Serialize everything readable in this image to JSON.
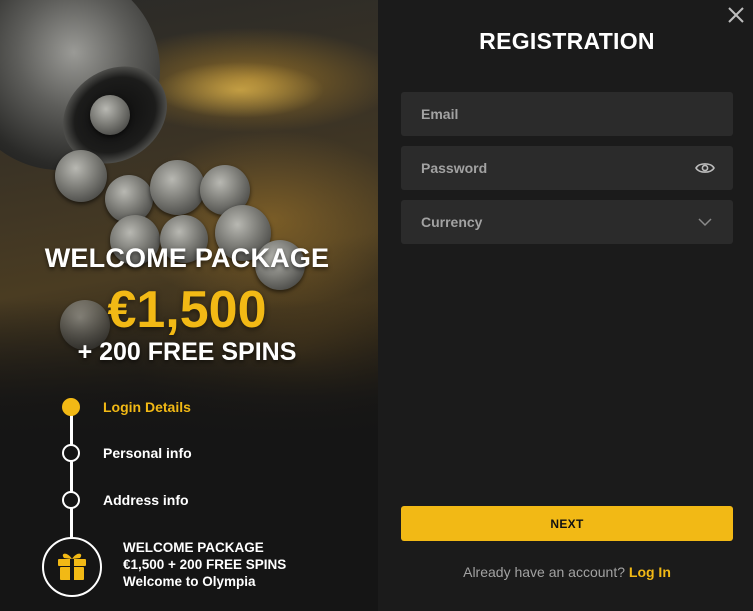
{
  "promo": {
    "title": "WELCOME PACKAGE",
    "amount": "€1,500",
    "spins": "+ 200 FREE SPINS"
  },
  "steps": [
    {
      "label": "Login Details",
      "active": true
    },
    {
      "label": "Personal info",
      "active": false
    },
    {
      "label": "Address info",
      "active": false
    }
  ],
  "bonus": {
    "line1": "WELCOME PACKAGE",
    "line2": "€1,500 + 200 FREE SPINS",
    "line3": "Welcome to Olympia"
  },
  "form": {
    "title": "REGISTRATION",
    "email_placeholder": "Email",
    "password_placeholder": "Password",
    "currency_label": "Currency",
    "next_label": "NEXT",
    "login_prompt": "Already have an account?",
    "login_link": "Log In"
  },
  "icons": {
    "close": "close-icon",
    "password_toggle": "eye-icon",
    "currency_dropdown": "chevron-down-icon",
    "bonus": "gift-icon"
  },
  "colors": {
    "accent": "#f2b915",
    "background": "#1b1b1b",
    "field": "#2b2b2b",
    "text_muted": "#a2a2a2"
  }
}
